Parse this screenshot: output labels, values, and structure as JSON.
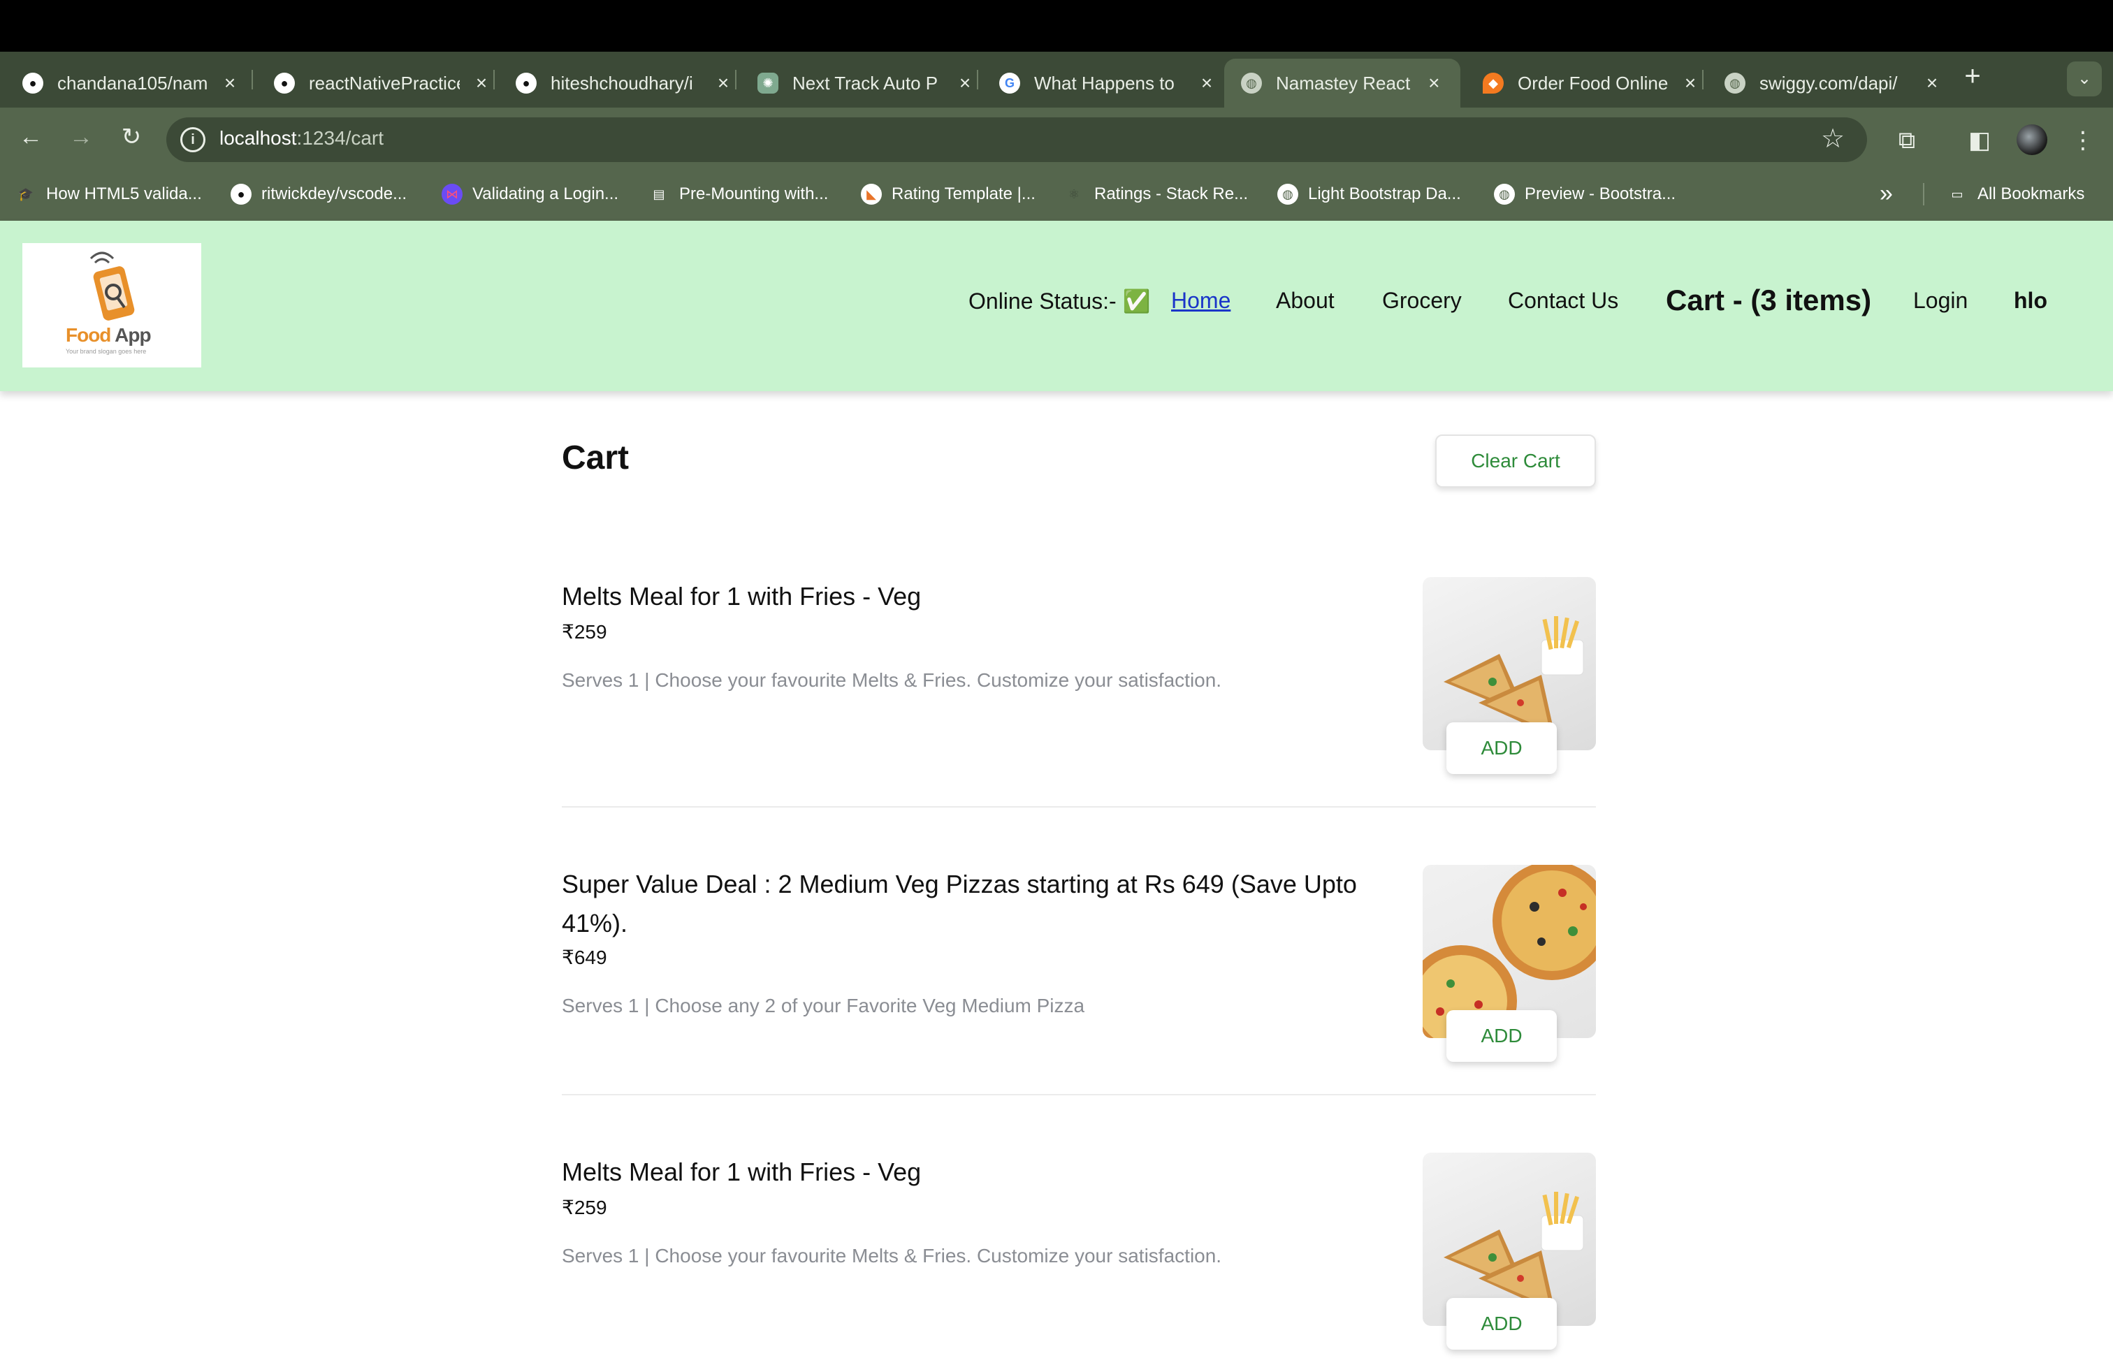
{
  "browser": {
    "tabs": [
      {
        "title": "chandana105/nam",
        "icon": "github-icon",
        "active": false
      },
      {
        "title": "reactNativePractice",
        "icon": "github-icon",
        "active": false
      },
      {
        "title": "hiteshchoudhary/i",
        "icon": "github-icon",
        "active": false
      },
      {
        "title": "Next Track Auto P",
        "icon": "chatgpt-icon",
        "active": false
      },
      {
        "title": "What Happens to",
        "icon": "google-icon",
        "active": false
      },
      {
        "title": "Namastey React",
        "icon": "globe-icon",
        "active": true
      },
      {
        "title": "Order Food Online",
        "icon": "swiggy-icon",
        "active": false
      },
      {
        "title": "swiggy.com/dapi/",
        "icon": "globe-icon",
        "active": false
      }
    ],
    "address": {
      "host": "localhost",
      "path": ":1234/cart"
    },
    "bookmarks": [
      {
        "label": "How HTML5 valida...",
        "icon": "graduation-cap-icon"
      },
      {
        "label": "ritwickdey/vscode...",
        "icon": "github-icon"
      },
      {
        "label": "Validating a Login...",
        "icon": "butterfly-icon"
      },
      {
        "label": "Pre-Mounting with...",
        "icon": "book-icon"
      },
      {
        "label": "Rating Template |...",
        "icon": "tag-icon"
      },
      {
        "label": "Ratings - Stack Re...",
        "icon": "react-icon"
      },
      {
        "label": "Light Bootstrap Da...",
        "icon": "globe-icon"
      },
      {
        "label": "Preview - Bootstra...",
        "icon": "globe-icon"
      }
    ],
    "all_bookmarks": "All Bookmarks"
  },
  "header": {
    "logo_text_food": "Food",
    "logo_text_app": "App",
    "logo_tagline": "Your brand slogan goes here",
    "online_status": "Online Status:- ✅",
    "nav": {
      "home": "Home",
      "about": "About",
      "grocery": "Grocery",
      "contact": "Contact Us",
      "cart": "Cart - (3 items)",
      "login": "Login",
      "user": "hlo"
    }
  },
  "cart": {
    "title": "Cart",
    "clear_label": "Clear Cart",
    "items": [
      {
        "name": "Melts Meal for 1 with Fries - Veg",
        "price": "₹259",
        "description": "Serves 1 | Choose your favourite Melts & Fries. Customize your satisfaction.",
        "add_label": "ADD"
      },
      {
        "name": "Super Value Deal : 2 Medium Veg Pizzas starting at Rs 649 (Save Upto 41%).",
        "price": "₹649",
        "description": "Serves 1 | Choose any 2 of your Favorite Veg Medium Pizza",
        "add_label": "ADD"
      },
      {
        "name": "Melts Meal for 1 with Fries - Veg",
        "price": "₹259",
        "description": "Serves 1 | Choose your favourite Melts & Fries. Customize your satisfaction.",
        "add_label": "ADD"
      }
    ]
  },
  "colors": {
    "header_bg": "#c8f3cf",
    "accent_green": "#2e8b3a",
    "link_blue": "#1a35c9",
    "chrome_dark": "#3c4a37",
    "chrome_mid": "#55664d"
  }
}
